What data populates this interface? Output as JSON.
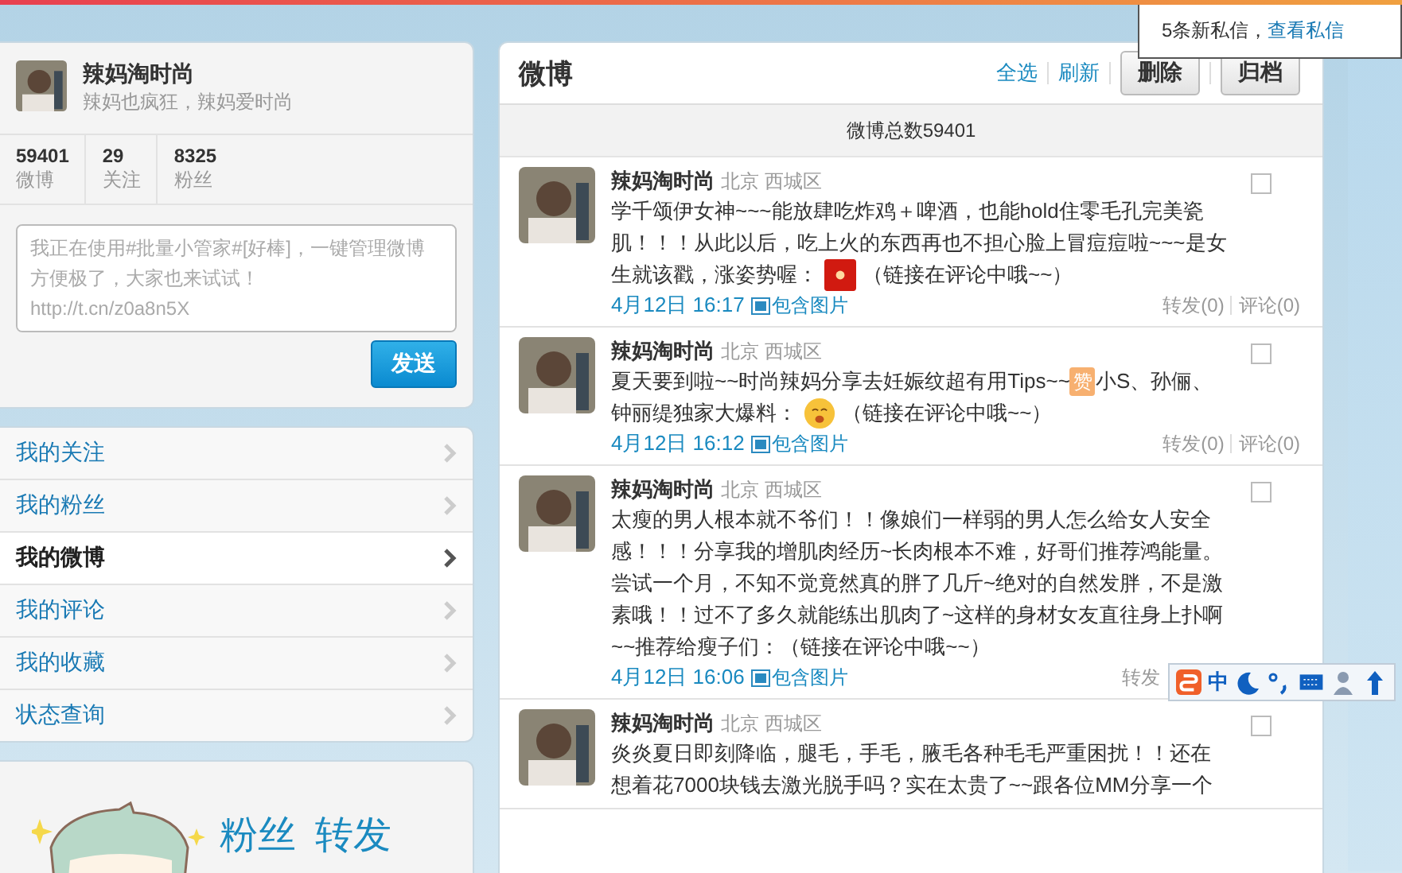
{
  "notification": {
    "text": "5条新私信，",
    "link": "查看私信"
  },
  "profile": {
    "name": "辣妈淘时尚",
    "bio": "辣妈也疯狂，辣妈爱时尚",
    "stats": [
      {
        "value": "59401",
        "label": "微博"
      },
      {
        "value": "29",
        "label": "关注"
      },
      {
        "value": "8325",
        "label": "粉丝"
      }
    ]
  },
  "composer": {
    "placeholder": "我正在使用#批量小管家#[好棒]，一键管理微博方便极了，大家也来试试！\nhttp://t.cn/z0a8n5X",
    "button": "发送"
  },
  "sidebar": {
    "items": [
      {
        "label": "我的关注",
        "selected": false
      },
      {
        "label": "我的粉丝",
        "selected": false
      },
      {
        "label": "我的微博",
        "selected": true
      },
      {
        "label": "我的评论",
        "selected": false
      },
      {
        "label": "我的收藏",
        "selected": false
      },
      {
        "label": "状态查询",
        "selected": false
      }
    ]
  },
  "promo": {
    "words": [
      "粉丝",
      "转发"
    ]
  },
  "feed": {
    "title": "微博",
    "links": [
      "全选",
      "刷新"
    ],
    "buttons": [
      "删除",
      "归档"
    ],
    "total": "微博总数59401",
    "posts": [
      {
        "author": "辣妈淘时尚",
        "location": "北京 西城区",
        "checked": false,
        "lines": [
          [
            {
              "kind": "text",
              "text": "学千颂伊女神~~~能放肆吃炸鸡＋啤酒，也能hold住零毛孔完美瓷"
            }
          ],
          [
            {
              "kind": "text",
              "text": "肌！！！从此以后，吃上火的东西再也不担心脸上冒痘痘啦~~~是女"
            }
          ],
          [
            {
              "kind": "text",
              "text": "生就该戳，涨姿势喔："
            },
            {
              "kind": "red-emoticon"
            },
            {
              "kind": "text",
              "text": "（链接在评论中哦~~）"
            }
          ]
        ],
        "time": "4月12日 16:17",
        "media": "包含图片",
        "repost": "转发(0)",
        "comment": "评论(0)"
      },
      {
        "author": "辣妈淘时尚",
        "location": "北京 西城区",
        "checked": false,
        "lines": [
          [
            {
              "kind": "text",
              "text": "夏天要到啦~~时尚辣妈分享去妊娠纹超有用Tips~~"
            },
            {
              "kind": "badge",
              "text": "赞"
            },
            {
              "kind": "text",
              "text": "小S、孙俪、"
            }
          ],
          [
            {
              "kind": "text",
              "text": "钟丽缇独家大爆料："
            },
            {
              "kind": "smiley"
            },
            {
              "kind": "text",
              "text": "（链接在评论中哦~~）"
            }
          ]
        ],
        "time": "4月12日 16:12",
        "media": "包含图片",
        "repost": "转发(0)",
        "comment": "评论(0)"
      },
      {
        "author": "辣妈淘时尚",
        "location": "北京 西城区",
        "checked": false,
        "lines": [
          [
            {
              "kind": "text",
              "text": "太瘦的男人根本就不爷们！！像娘们一样弱的男人怎么给女人安全"
            }
          ],
          [
            {
              "kind": "text",
              "text": "感！！！分享我的增肌肉经历~长肉根本不难，好哥们推荐鸿能量。"
            }
          ],
          [
            {
              "kind": "text",
              "text": "尝试一个月，不知不觉竟然真的胖了几斤~绝对的自然发胖，不是激"
            }
          ],
          [
            {
              "kind": "text",
              "text": "素哦！！过不了多久就能练出肌肉了~这样的身材女友直往身上扑啊"
            }
          ],
          [
            {
              "kind": "text",
              "text": "~~推荐给瘦子们：（链接在评论中哦~~）"
            }
          ]
        ],
        "time": "4月12日 16:06",
        "media": "包含图片",
        "repost": "转发"
      },
      {
        "author": "辣妈淘时尚",
        "location": "北京 西城区",
        "checked": false,
        "lines": [
          [
            {
              "kind": "text",
              "text": "炎炎夏日即刻降临，腿毛，手毛，腋毛各种毛毛严重困扰！！还在"
            }
          ],
          [
            {
              "kind": "text",
              "text": "想着花7000块钱去激光脱手吗？实在太贵了~~跟各位MM分享一个"
            }
          ]
        ]
      }
    ]
  },
  "ime_bar": {
    "mode": "中"
  }
}
